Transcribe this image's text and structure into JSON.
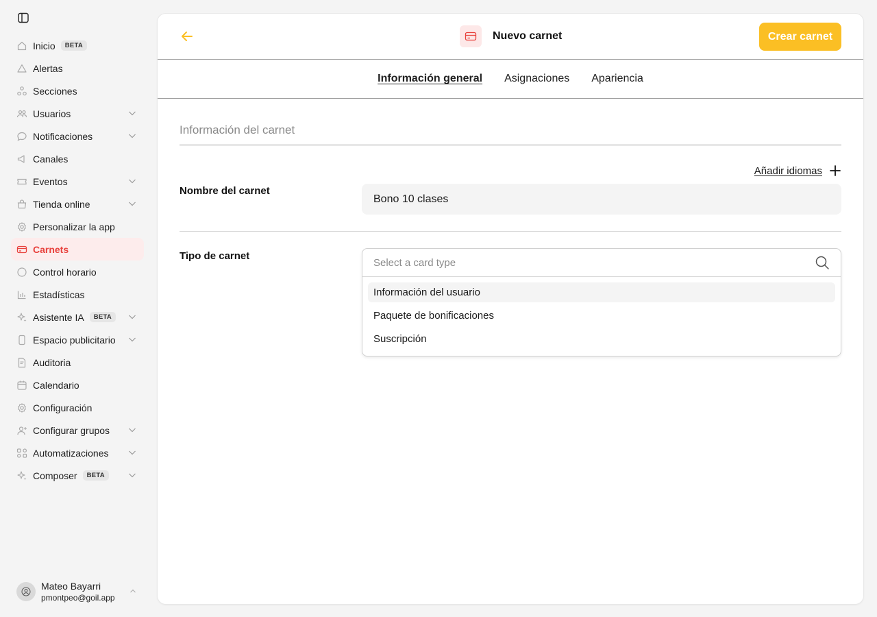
{
  "sidebar": {
    "items": [
      {
        "label": "Inicio",
        "badge": "BETA",
        "icon": "home-icon"
      },
      {
        "label": "Alertas",
        "icon": "alert-icon"
      },
      {
        "label": "Secciones",
        "icon": "sections-icon"
      },
      {
        "label": "Usuarios",
        "icon": "users-icon"
      },
      {
        "label": "Notificaciones",
        "icon": "chat-icon"
      },
      {
        "label": "Canales",
        "icon": "megaphone-icon"
      },
      {
        "label": "Eventos",
        "icon": "ticket-icon"
      },
      {
        "label": "Tienda online",
        "icon": "shop-icon"
      },
      {
        "label": "Personalizar la app",
        "icon": "gear-icon"
      },
      {
        "label": "Carnets",
        "icon": "card-icon"
      },
      {
        "label": "Control horario",
        "icon": "clock-icon"
      },
      {
        "label": "Estadísticas",
        "icon": "chart-icon"
      },
      {
        "label": "Asistente IA",
        "badge": "BETA",
        "icon": "sparkle-icon"
      },
      {
        "label": "Espacio publicitario",
        "icon": "phone-icon"
      },
      {
        "label": "Auditoria",
        "icon": "document-icon"
      },
      {
        "label": "Calendario",
        "icon": "calendar-icon"
      },
      {
        "label": "Configuración",
        "icon": "gear-icon"
      },
      {
        "label": "Configurar grupos",
        "icon": "user-group-icon"
      },
      {
        "label": "Automatizaciones",
        "icon": "flow-icon"
      },
      {
        "label": "Composer",
        "badge": "BETA",
        "icon": "sparkle-icon"
      }
    ]
  },
  "user": {
    "name": "Mateo Bayarri",
    "email": "pmontpeo@goil.app"
  },
  "header": {
    "title": "Nuevo carnet",
    "create_label": "Crear carnet"
  },
  "tabs": [
    {
      "label": "Información general"
    },
    {
      "label": "Asignaciones"
    },
    {
      "label": "Apariencia"
    }
  ],
  "form": {
    "section_title": "Información del carnet",
    "add_languages": "Añadir idiomas",
    "name_label": "Nombre del carnet",
    "name_value": "Bono 10 clases",
    "type_label": "Tipo de carnet",
    "type_placeholder": "Select a card type",
    "type_options": [
      "Información del usuario",
      "Paquete de bonificaciones",
      "Suscripción"
    ]
  },
  "colors": {
    "accent": "#fbbf24",
    "active": "#e8413c",
    "active_bg": "#fdecec"
  }
}
